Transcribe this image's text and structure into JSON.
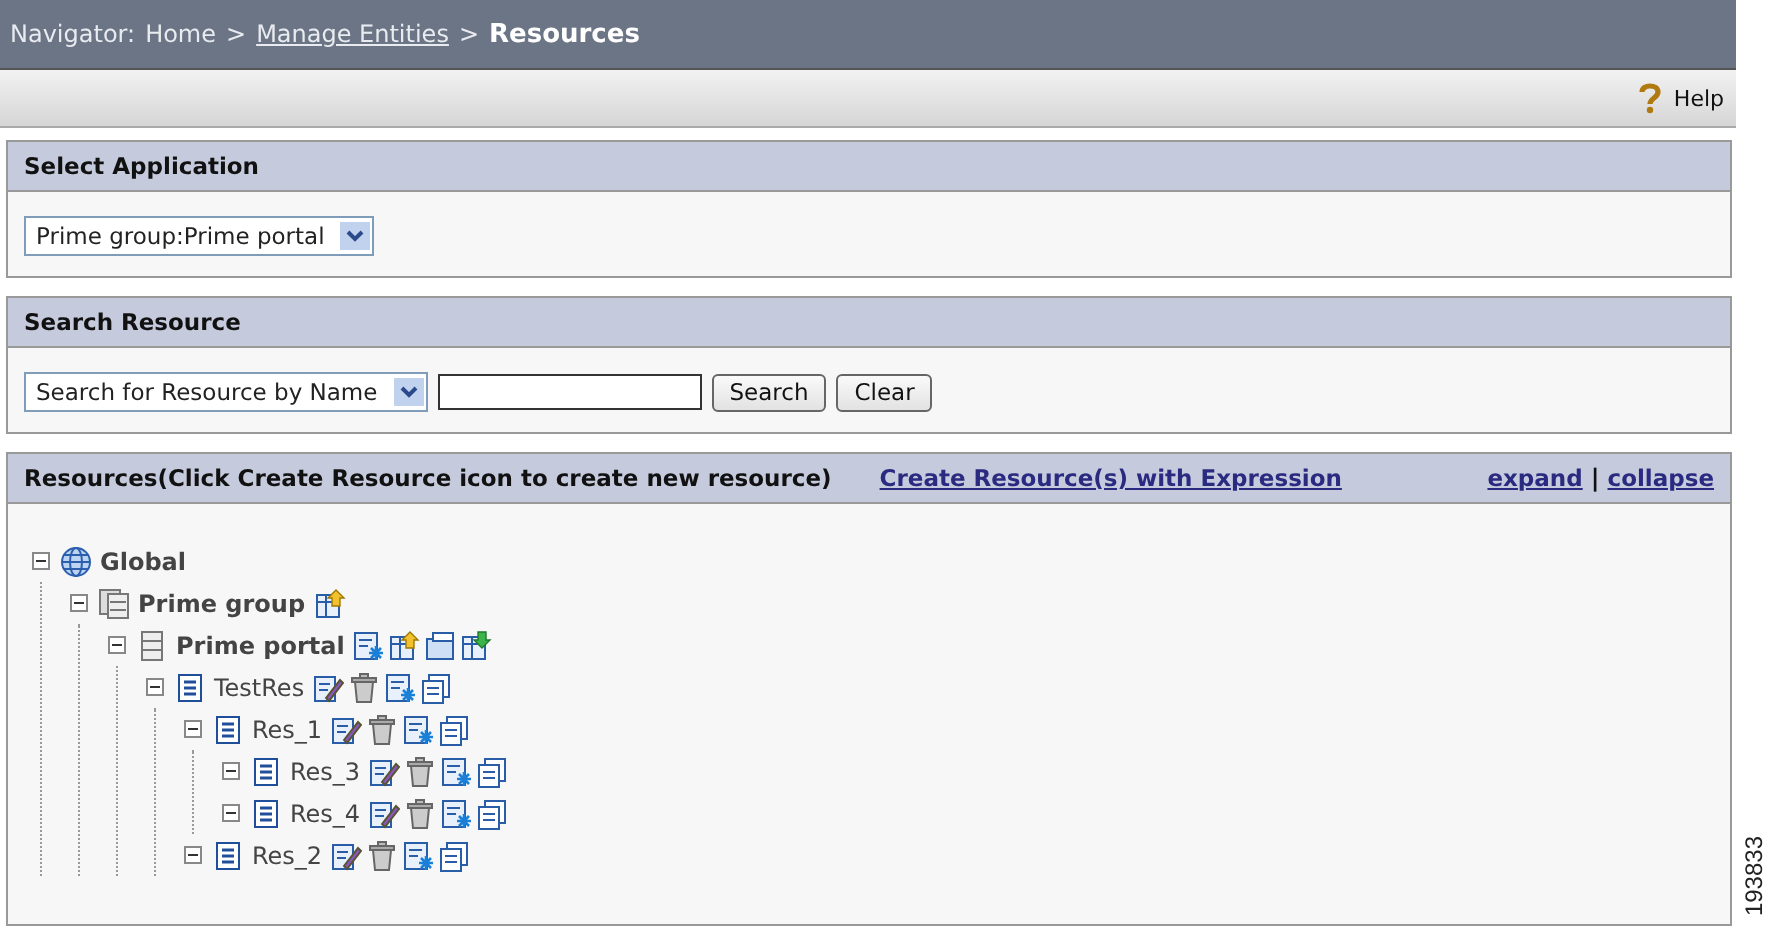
{
  "navigator": {
    "label": "Navigator:",
    "crumbs": [
      {
        "text": "Home",
        "kind": "plain"
      },
      {
        "text": "Manage Entities",
        "kind": "link"
      },
      {
        "text": "Resources",
        "kind": "current"
      }
    ],
    "separator": ">"
  },
  "toolbar": {
    "help": "Help"
  },
  "select_application": {
    "title": "Select Application",
    "dropdown": {
      "value": "Prime group:Prime portal"
    }
  },
  "search_resource": {
    "title": "Search Resource",
    "dropdown": {
      "value": "Search for Resource by Name"
    },
    "buttons": [
      "Search",
      "Clear"
    ]
  },
  "resources": {
    "title": "Resources(Click Create Resource icon to create new resource)",
    "create_link": "Create Resource(s) with Expression",
    "expand_link": "expand",
    "divider": "|",
    "collapse_link": "collapse",
    "tree": [
      {
        "label": "Global",
        "kind": "root",
        "bold": true,
        "expanded": true,
        "children": [
          {
            "label": "Prime group",
            "kind": "group",
            "bold": true,
            "expanded": true,
            "actions": [
              {
                "kind": "create"
              }
            ],
            "children": [
              {
                "label": "Prime portal",
                "kind": "application",
                "bold": true,
                "expanded": true,
                "actions": [
                  {
                    "kind": "properties"
                  },
                  {
                    "kind": "create"
                  },
                  {
                    "kind": "folder"
                  },
                  {
                    "kind": "import"
                  }
                ],
                "children": [
                  {
                    "label": "TestRes",
                    "kind": "resource",
                    "bold": false,
                    "expanded": true,
                    "actions": [
                      {
                        "kind": "edit"
                      },
                      {
                        "kind": "delete"
                      },
                      {
                        "kind": "properties"
                      },
                      {
                        "kind": "copy"
                      }
                    ],
                    "children": [
                      {
                        "label": "Res_1",
                        "kind": "resource",
                        "bold": false,
                        "expanded": true,
                        "actions": [
                          {
                            "kind": "edit"
                          },
                          {
                            "kind": "delete"
                          },
                          {
                            "kind": "properties"
                          },
                          {
                            "kind": "copy"
                          }
                        ],
                        "children": [
                          {
                            "label": "Res_3",
                            "kind": "resource",
                            "bold": false,
                            "expanded": true,
                            "actions": [
                              {
                                "kind": "edit"
                              },
                              {
                                "kind": "delete"
                              },
                              {
                                "kind": "properties"
                              },
                              {
                                "kind": "copy"
                              }
                            ]
                          },
                          {
                            "label": "Res_4",
                            "kind": "resource",
                            "bold": false,
                            "expanded": true,
                            "actions": [
                              {
                                "kind": "edit"
                              },
                              {
                                "kind": "delete"
                              },
                              {
                                "kind": "properties"
                              },
                              {
                                "kind": "copy"
                              }
                            ]
                          }
                        ]
                      },
                      {
                        "label": "Res_2",
                        "kind": "resource",
                        "bold": false,
                        "expanded": true,
                        "actions": [
                          {
                            "kind": "edit"
                          },
                          {
                            "kind": "delete"
                          },
                          {
                            "kind": "properties"
                          },
                          {
                            "kind": "copy"
                          }
                        ]
                      }
                    ]
                  }
                ]
              }
            ]
          }
        ]
      }
    ]
  },
  "figure_id": "193833"
}
